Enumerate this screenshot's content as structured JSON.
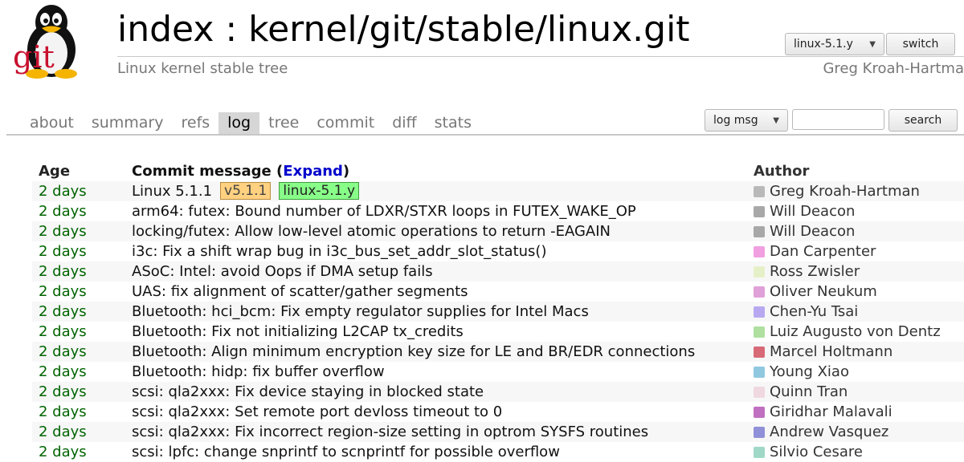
{
  "header": {
    "title": "index : kernel/git/stable/linux.git",
    "subtitle": "Linux kernel stable tree",
    "owner": "Greg Kroah-Hartma",
    "logo_text": "git",
    "branch_selected": "linux-5.1.y",
    "switch_label": "switch"
  },
  "tabs": [
    {
      "label": "about",
      "active": false
    },
    {
      "label": "summary",
      "active": false
    },
    {
      "label": "refs",
      "active": false
    },
    {
      "label": "log",
      "active": true
    },
    {
      "label": "tree",
      "active": false
    },
    {
      "label": "commit",
      "active": false
    },
    {
      "label": "diff",
      "active": false
    },
    {
      "label": "stats",
      "active": false
    }
  ],
  "search": {
    "mode_selected": "log msg",
    "query": "",
    "button_label": "search"
  },
  "log": {
    "headers": {
      "age": "Age",
      "message": "Commit message",
      "expand_open": "(",
      "expand": "Expand",
      "expand_close": ")",
      "author": "Author"
    },
    "rows": [
      {
        "age": "2 days",
        "message": "Linux 5.1.1",
        "tag": "v5.1.1",
        "branch": "linux-5.1.y",
        "author": "Greg Kroah-Hartman",
        "avatar_color": "#b9b9b9"
      },
      {
        "age": "2 days",
        "message": "arm64: futex: Bound number of LDXR/STXR loops in FUTEX_WAKE_OP",
        "author": "Will Deacon",
        "avatar_color": "#a8a8a8"
      },
      {
        "age": "2 days",
        "message": "locking/futex: Allow low-level atomic operations to return -EAGAIN",
        "author": "Will Deacon",
        "avatar_color": "#a8a8a8"
      },
      {
        "age": "2 days",
        "message": "i3c: Fix a shift wrap bug in i3c_bus_set_addr_slot_status()",
        "author": "Dan Carpenter",
        "avatar_color": "#f0a0e0"
      },
      {
        "age": "2 days",
        "message": "ASoC: Intel: avoid Oops if DMA setup fails",
        "author": "Ross Zwisler",
        "avatar_color": "#e6f0c8"
      },
      {
        "age": "2 days",
        "message": "UAS: fix alignment of scatter/gather segments",
        "author": "Oliver Neukum",
        "avatar_color": "#e0a0d8"
      },
      {
        "age": "2 days",
        "message": "Bluetooth: hci_bcm: Fix empty regulator supplies for Intel Macs",
        "author": "Chen-Yu Tsai",
        "avatar_color": "#b8a8f0"
      },
      {
        "age": "2 days",
        "message": "Bluetooth: Fix not initializing L2CAP tx_credits",
        "author": "Luiz Augusto von Dentz",
        "avatar_color": "#b0e0a0"
      },
      {
        "age": "2 days",
        "message": "Bluetooth: Align minimum encryption key size for LE and BR/EDR connections",
        "author": "Marcel Holtmann",
        "avatar_color": "#d86a78"
      },
      {
        "age": "2 days",
        "message": "Bluetooth: hidp: fix buffer overflow",
        "author": "Young Xiao",
        "avatar_color": "#90c8e0"
      },
      {
        "age": "2 days",
        "message": "scsi: qla2xxx: Fix device staying in blocked state",
        "author": "Quinn Tran",
        "avatar_color": "#f0d8e0"
      },
      {
        "age": "2 days",
        "message": "scsi: qla2xxx: Set remote port devloss timeout to 0",
        "author": "Giridhar Malavali",
        "avatar_color": "#c070c0"
      },
      {
        "age": "2 days",
        "message": "scsi: qla2xxx: Fix incorrect region-size setting in optrom SYSFS routines",
        "author": "Andrew Vasquez",
        "avatar_color": "#9090d8"
      },
      {
        "age": "2 days",
        "message": "scsi: lpfc: change snprintf to scnprintf for possible overflow",
        "author": "Silvio Cesare",
        "avatar_color": "#a0d8c8"
      }
    ]
  }
}
